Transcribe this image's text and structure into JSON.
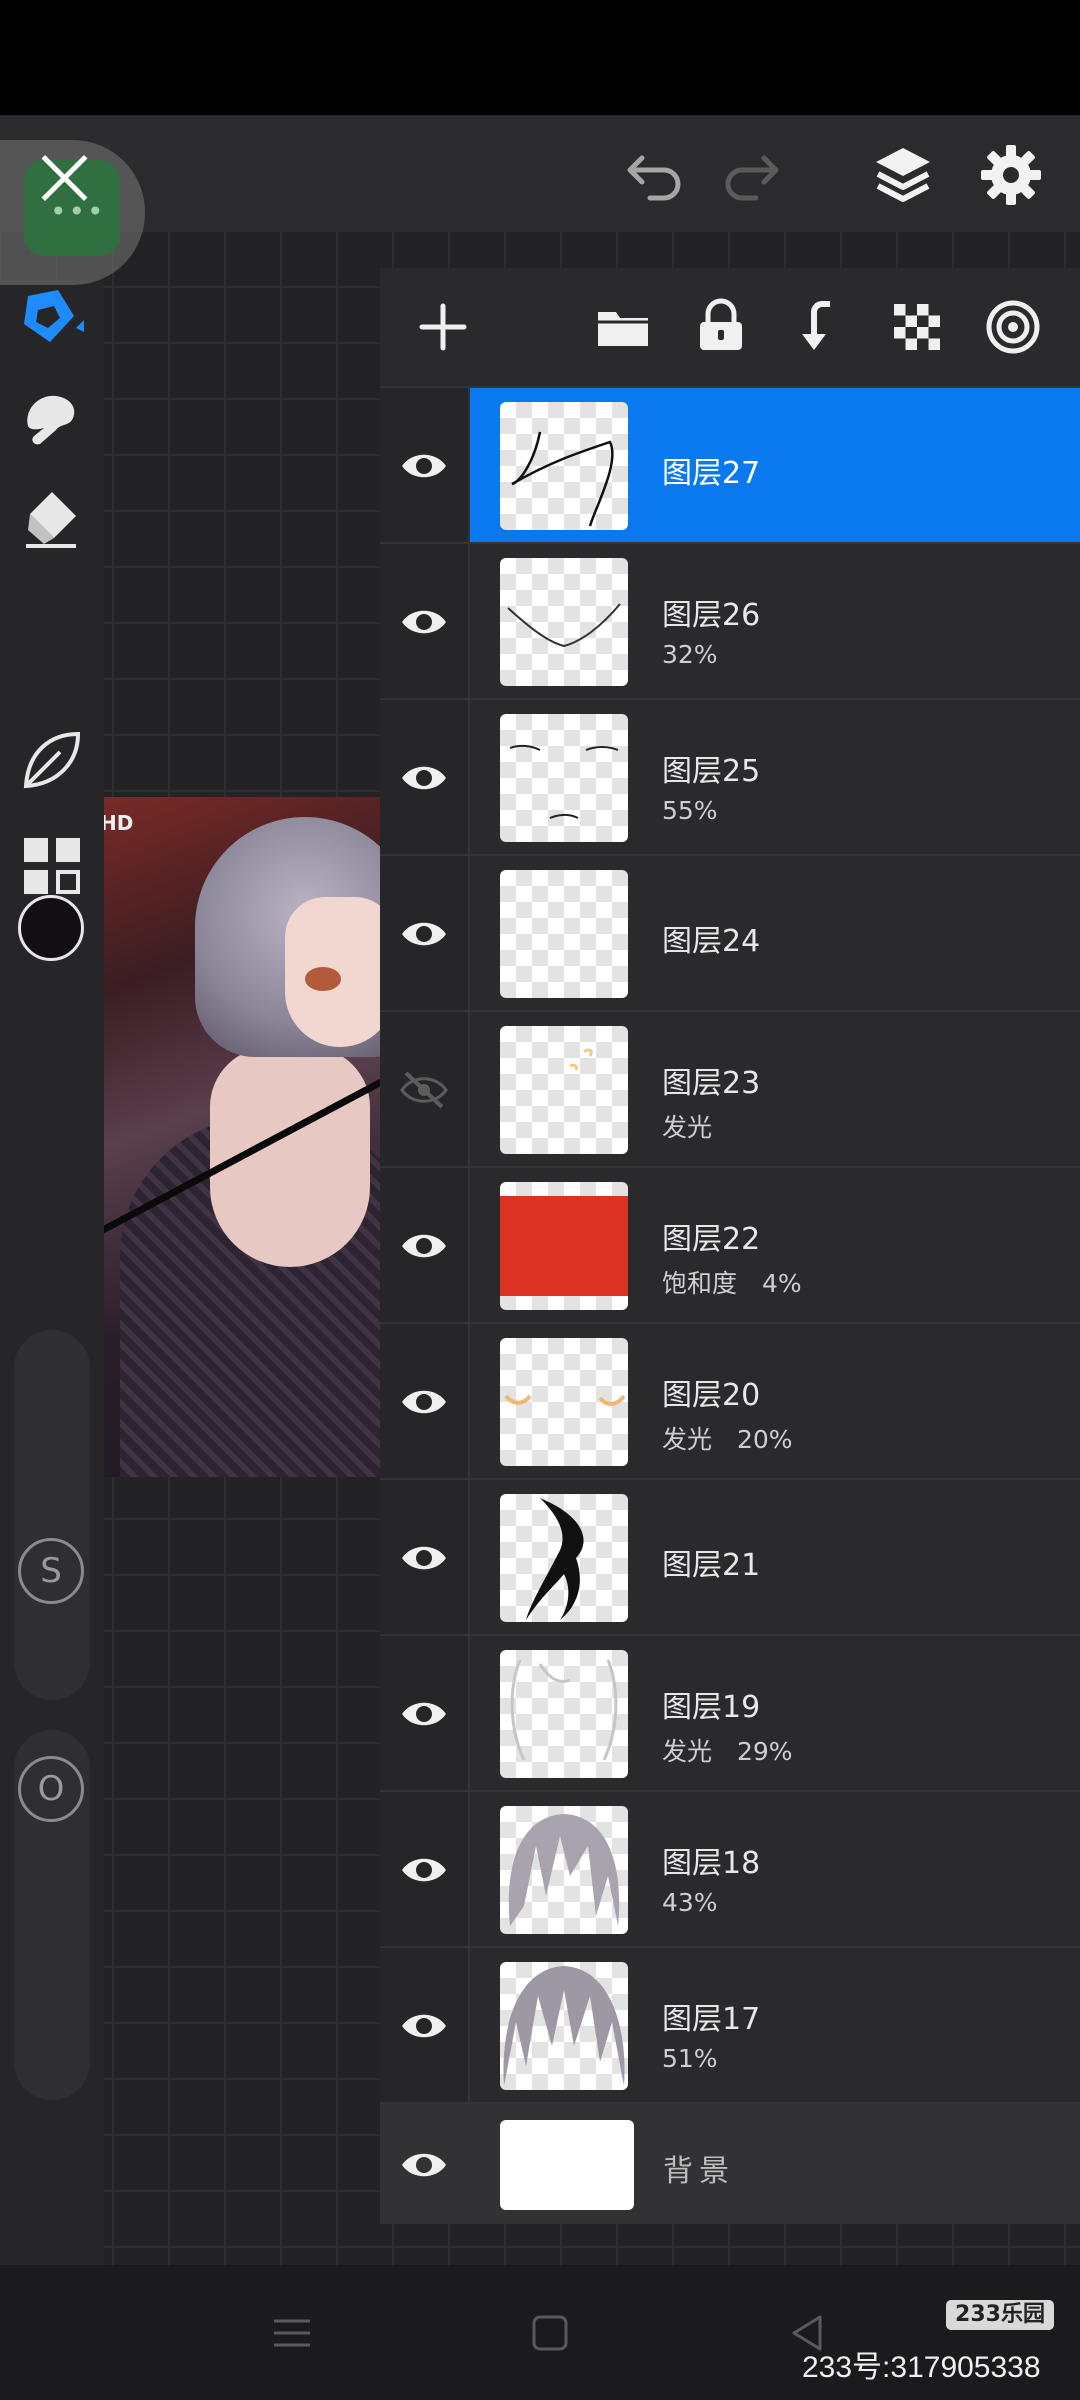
{
  "toolbar": {
    "icons": [
      "close-icon",
      "undo-icon",
      "redo-icon",
      "layers-icon",
      "gear-icon"
    ]
  },
  "sidebar": {
    "tools": [
      "pen-icon",
      "smudge-icon",
      "eraser-icon",
      "color-swatch",
      "leaf-icon",
      "grid-icon"
    ],
    "color": "#120e14",
    "size_slider_label": "S",
    "opacity_slider_label": "O"
  },
  "layers_toolbar": {
    "icons": [
      "add-layer-icon",
      "folder-icon",
      "lock-icon",
      "merge-down-icon",
      "transparency-icon",
      "layer-effects-icon"
    ]
  },
  "layers": [
    {
      "name": "图层27",
      "meta": "",
      "visible": true,
      "selected": true
    },
    {
      "name": "图层26",
      "meta": "32%",
      "visible": true
    },
    {
      "name": "图层25",
      "meta": "55%",
      "visible": true
    },
    {
      "name": "图层24",
      "meta": "",
      "visible": true
    },
    {
      "name": "图层23",
      "meta": "发光",
      "visible": false
    },
    {
      "name": "图层22",
      "meta": "饱和度　4%",
      "visible": true
    },
    {
      "name": "图层20",
      "meta": "发光　20%",
      "visible": true
    },
    {
      "name": "图层21",
      "meta": "",
      "visible": true
    },
    {
      "name": "图层19",
      "meta": "发光　29%",
      "visible": true
    },
    {
      "name": "图层18",
      "meta": "43%",
      "visible": true
    },
    {
      "name": "图层17",
      "meta": "51%",
      "visible": true
    }
  ],
  "background_layer": {
    "name": "背景",
    "visible": true
  },
  "artwork": {
    "label": "HD"
  },
  "colors": {
    "accent": "#0a79f0",
    "layer22_fill": "#dc3224"
  },
  "watermark": {
    "badge": "233乐园",
    "id": "233号:317905338"
  }
}
